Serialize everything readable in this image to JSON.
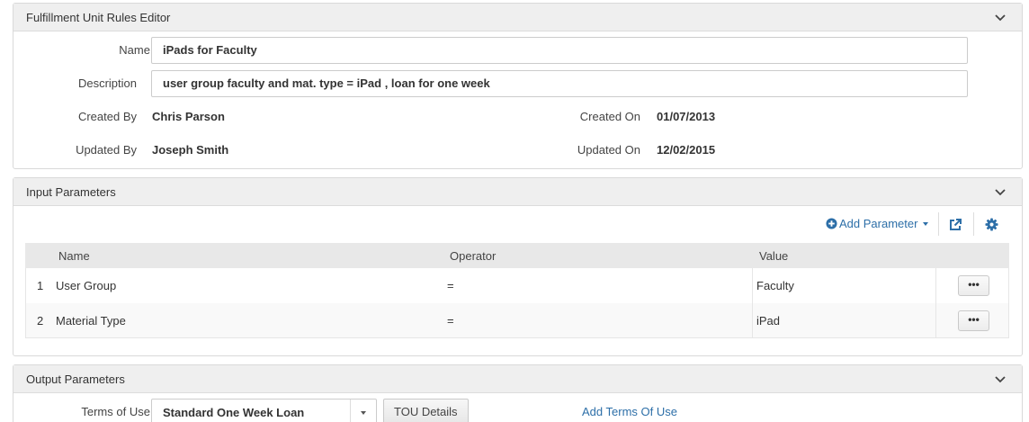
{
  "rules_editor": {
    "title": "Fulfillment Unit Rules Editor",
    "name_label": "Name",
    "name_value": "iPads for Faculty",
    "description_label": "Description",
    "description_value": "user group faculty and mat. type = iPad , loan for one week",
    "created_by_label": "Created By",
    "created_by_value": "Chris Parson",
    "created_on_label": "Created On",
    "created_on_value": "01/07/2013",
    "updated_by_label": "Updated By",
    "updated_by_value": "Joseph Smith",
    "updated_on_label": "Updated On",
    "updated_on_value": "12/02/2015",
    "required_marker": "*"
  },
  "input_parameters": {
    "title": "Input Parameters",
    "add_parameter_label": "Add Parameter",
    "columns": {
      "name": "Name",
      "operator": "Operator",
      "value": "Value"
    },
    "rows": [
      {
        "index": "1",
        "name": "User Group",
        "operator": "=",
        "value": "Faculty",
        "action": "•••"
      },
      {
        "index": "2",
        "name": "Material Type",
        "operator": "=",
        "value": "iPad",
        "action": "•••"
      }
    ]
  },
  "output_parameters": {
    "title": "Output Parameters",
    "terms_label": "Terms of Use",
    "terms_value": "Standard One Week Loan",
    "tou_details_label": "TOU Details",
    "add_terms_label": "Add Terms Of Use"
  },
  "colors": {
    "link": "#2d6fa8",
    "required": "#d9534f",
    "header_bg": "#efefef"
  }
}
